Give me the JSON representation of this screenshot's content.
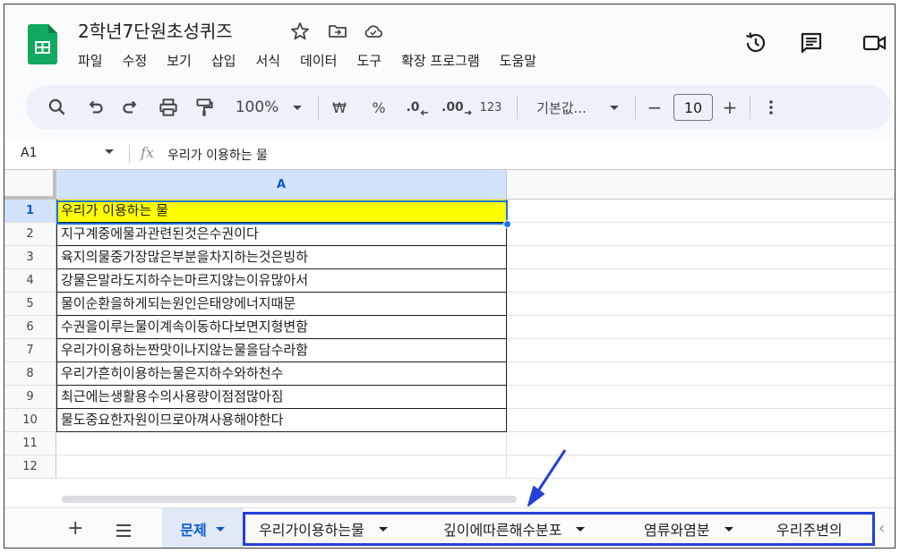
{
  "document": {
    "title": "2학년7단원초성퀴즈"
  },
  "menu": [
    "파일",
    "수정",
    "보기",
    "삽입",
    "서식",
    "데이터",
    "도구",
    "확장 프로그램",
    "도움말"
  ],
  "toolbar": {
    "zoom": "100%",
    "currency": "₩",
    "percent": "%",
    "decimal_decrease": ".0",
    "decimal_increase": ".00",
    "number_format": "123",
    "font": "기본값...",
    "font_size": "10",
    "minus": "−",
    "plus": "+"
  },
  "formula_bar": {
    "name_box": "A1",
    "fx": "fx",
    "content": "우리가 이용하는 물"
  },
  "grid": {
    "column_header": "A",
    "rows": [
      {
        "num": "1",
        "text": "우리가 이용하는 물"
      },
      {
        "num": "2",
        "text": "지구계중에물과관련된것은수권이다"
      },
      {
        "num": "3",
        "text": "육지의물중가장많은부분을차지하는것은빙하"
      },
      {
        "num": "4",
        "text": "강물은말라도지하수는마르지않는이유많아서"
      },
      {
        "num": "5",
        "text": "물이순환을하게되는원인은태양에너지때문"
      },
      {
        "num": "6",
        "text": "수권을이루는물이계속이동하다보면지형변함"
      },
      {
        "num": "7",
        "text": "우리가이용하는짠맛이나지않는물을담수라함"
      },
      {
        "num": "8",
        "text": "우리가흔히이용하는물은지하수와하천수"
      },
      {
        "num": "9",
        "text": "최근에는생활용수의사용량이점점많아짐"
      },
      {
        "num": "10",
        "text": "물도중요한자원이므로아껴사용해야한다"
      },
      {
        "num": "11",
        "text": ""
      },
      {
        "num": "12",
        "text": ""
      }
    ]
  },
  "sheets": {
    "add": "+",
    "active": "문제",
    "tabs": [
      "우리가이용하는물",
      "깊이에따른해수분포",
      "염류와염분",
      "우리주변의"
    ],
    "scroll_left": "‹"
  },
  "colors": {
    "accent": "#0b57d0",
    "highlight_cell": "#ffff00",
    "annotation": "#2440d8"
  }
}
